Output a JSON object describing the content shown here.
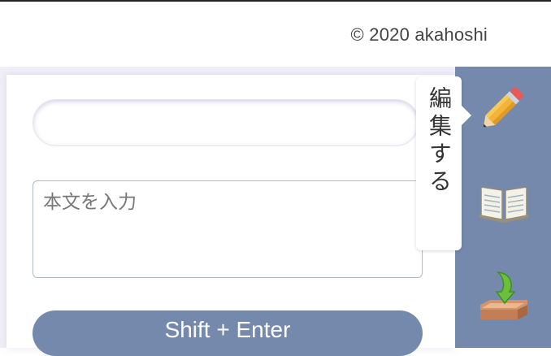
{
  "header": {
    "copyright": "© 2020 akahoshi"
  },
  "editor": {
    "title_placeholder": "",
    "body_placeholder": "本文を入力",
    "submit_label": "Shift + Enter"
  },
  "sidebar": {
    "tooltip": "編集する",
    "items": [
      {
        "icon": "pencil-icon",
        "label": "編集する"
      },
      {
        "icon": "open-book-icon"
      },
      {
        "icon": "inbox-download-icon"
      }
    ]
  },
  "colors": {
    "sidebar_bg": "#7489ac",
    "button_bg": "#7589ad",
    "panel_bg": "#f1eff8"
  }
}
